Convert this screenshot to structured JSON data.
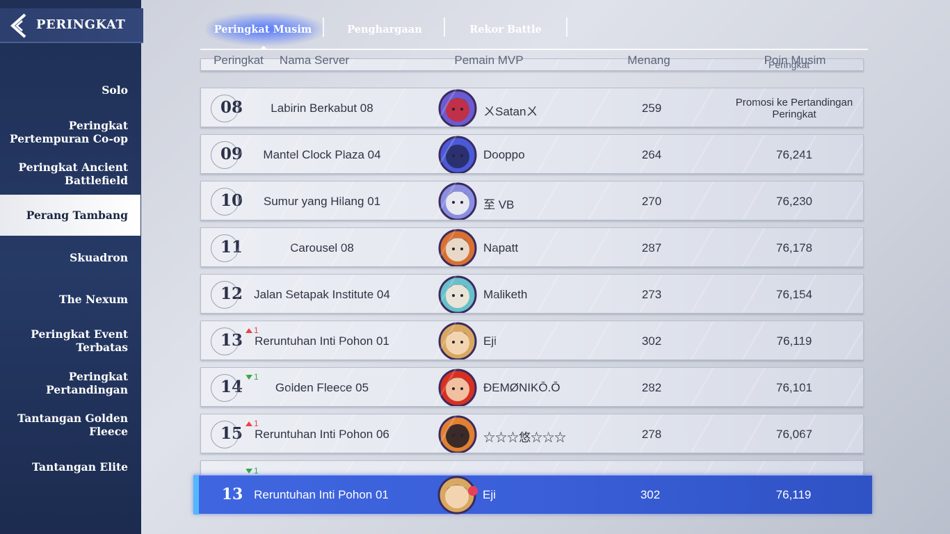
{
  "header": {
    "title": "PERINGKAT"
  },
  "sidebar": {
    "items": [
      {
        "label": "Solo"
      },
      {
        "label": "Peringkat Pertempuran Co-op"
      },
      {
        "label": "Peringkat Ancient Battlefield"
      },
      {
        "label": "Perang Tambang"
      },
      {
        "label": "Skuadron"
      },
      {
        "label": "The Nexum"
      },
      {
        "label": "Peringkat Event Terbatas"
      },
      {
        "label": "Peringkat Pertandingan"
      },
      {
        "label": "Tantangan Golden Fleece"
      },
      {
        "label": "Tantangan Elite"
      }
    ],
    "active_item": "Perang Tambang"
  },
  "tabs": [
    {
      "label": "Peringkat Musim"
    },
    {
      "label": "Penghargaan"
    },
    {
      "label": "Rekor Battle"
    }
  ],
  "active_tab": "Peringkat Musim",
  "table": {
    "columns": [
      "Peringkat",
      "Nama Server",
      "Pemain MVP",
      "Menang",
      "Poin Musim"
    ],
    "partial_top_text": "Peringkat",
    "rows": [
      {
        "rank": "08",
        "server": "Labirin Berkabut 08",
        "mvp": "ㄨSatanㄨ",
        "wins": "259",
        "points": "Promosi ke Pertandingan Peringkat",
        "trend": ""
      },
      {
        "rank": "09",
        "server": "Mantel Clock Plaza 04",
        "mvp": "Dooppo",
        "wins": "264",
        "points": "76,241",
        "trend": ""
      },
      {
        "rank": "10",
        "server": "Sumur yang Hilang 01",
        "mvp": "至 VB",
        "wins": "270",
        "points": "76,230",
        "trend": ""
      },
      {
        "rank": "11",
        "server": "Carousel 08",
        "mvp": "Napatt",
        "wins": "287",
        "points": "76,178",
        "trend": ""
      },
      {
        "rank": "12",
        "server": "Jalan Setapak Institute 04",
        "mvp": "Maliketh",
        "wins": "273",
        "points": "76,154",
        "trend": ""
      },
      {
        "rank": "13",
        "server": "Reruntuhan Inti Pohon 01",
        "mvp": "Eji",
        "wins": "302",
        "points": "76,119",
        "trend": "up",
        "trend_value": "1"
      },
      {
        "rank": "14",
        "server": "Golden Fleece 05",
        "mvp": "ÐEMØNIKŌ.Ō",
        "wins": "282",
        "points": "76,101",
        "trend": "down",
        "trend_value": "1"
      },
      {
        "rank": "15",
        "server": "Reruntuhan Inti Pohon 06",
        "mvp": "☆☆☆悠☆☆☆",
        "wins": "278",
        "points": "76,067",
        "trend": "up",
        "trend_value": "1"
      }
    ],
    "partial_bottom_trend_value": "1",
    "self_row": {
      "rank": "13",
      "server": "Reruntuhan Inti Pohon 01",
      "mvp": "Eji",
      "wins": "302",
      "points": "76,119"
    }
  },
  "colors": {
    "sidebar_bg": "#1f2f55",
    "self_row_bg": "#3f66e0",
    "trend_up": "#e84545",
    "trend_down": "#39a845"
  },
  "icons": [
    "back-arrow-icon",
    "mvp-avatar-icon",
    "trend-up-icon",
    "trend-down-icon"
  ]
}
